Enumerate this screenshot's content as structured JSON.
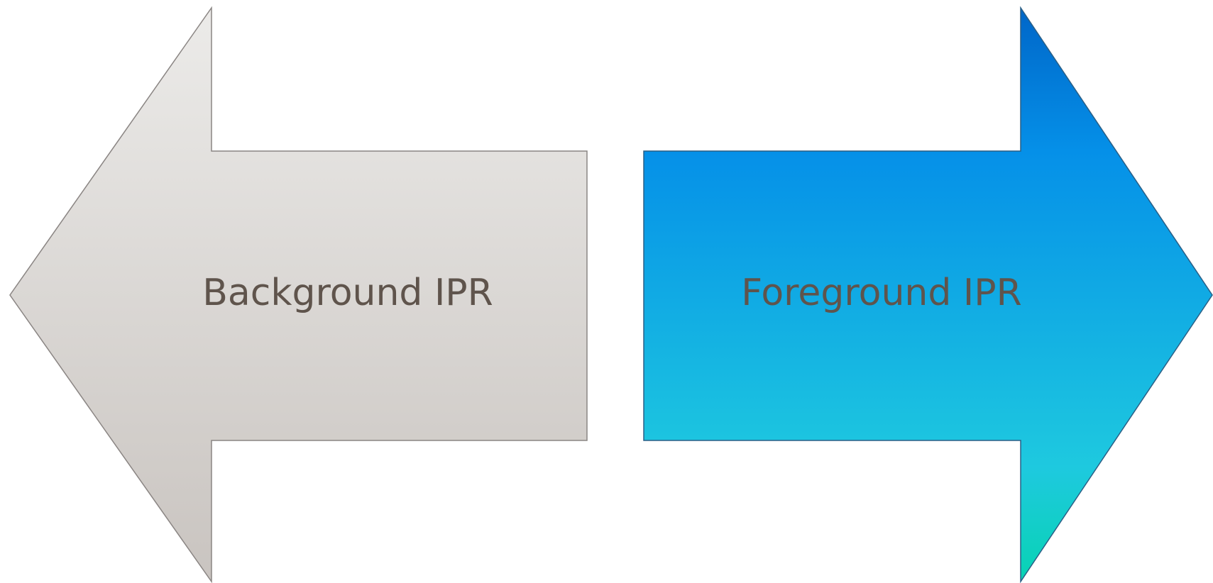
{
  "diagram": {
    "left_arrow": {
      "label": "Background IPR",
      "direction": "left",
      "gradient_colors": [
        "#ecebe9",
        "#c9c4c0"
      ],
      "stroke_color": "#8a8583"
    },
    "right_arrow": {
      "label": "Foreground IPR",
      "direction": "right",
      "gradient_colors": [
        "#0066c8",
        "#0590e8",
        "#1ec9df",
        "#08d3b3"
      ],
      "stroke_color": "#2a5f86"
    },
    "label_color": "#5f544c"
  }
}
